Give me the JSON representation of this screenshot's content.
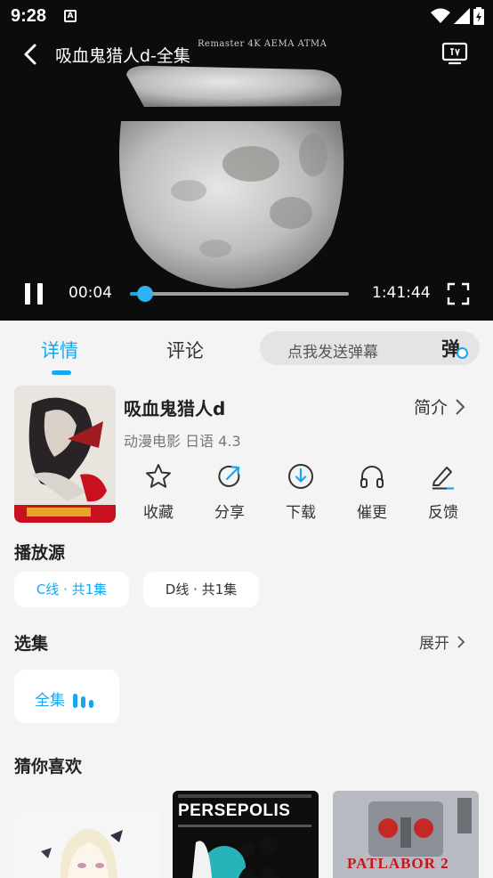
{
  "status_bar": {
    "time": "9:28",
    "notification_icon_letter": "A"
  },
  "player": {
    "title": "吸血鬼猎人d-全集",
    "watermark": "Remaster 4K AEMA ATMA",
    "current_time": "00:04",
    "total_time": "1:41:44",
    "progress_percent": 0.07,
    "icons": [
      "back-icon",
      "tv-cast-icon",
      "pause-icon",
      "fullscreen-icon"
    ]
  },
  "tabs": [
    {
      "label": "详情",
      "active": true
    },
    {
      "label": "评论",
      "active": false
    }
  ],
  "danmaku": {
    "placeholder": "点我发送弹幕",
    "icon_char": "弹"
  },
  "show": {
    "title": "吸血鬼猎人d",
    "meta": "动漫电影 日语 4.3",
    "intro_label": "简介"
  },
  "actions": [
    {
      "label": "收藏",
      "icon": "star-icon"
    },
    {
      "label": "分享",
      "icon": "share-icon"
    },
    {
      "label": "下载",
      "icon": "download-icon"
    },
    {
      "label": "催更",
      "icon": "headphones-icon"
    },
    {
      "label": "反馈",
      "icon": "edit-icon"
    }
  ],
  "sources": {
    "title": "播放源",
    "items": [
      {
        "label": "C线 · 共1集",
        "active": true
      },
      {
        "label": "D线 · 共1集",
        "active": false
      }
    ]
  },
  "episodes": {
    "title": "选集",
    "expand_label": "展开",
    "items": [
      {
        "label": "全集",
        "playing": true
      }
    ]
  },
  "recommend": {
    "title": "猜你喜欢",
    "poster_text": [
      "PERSEPOLIS",
      "PATLABOR 2"
    ]
  },
  "colors": {
    "accent": "#19a7ec",
    "background": "#f4f4f5",
    "player_bg": "#0b0c0c"
  }
}
